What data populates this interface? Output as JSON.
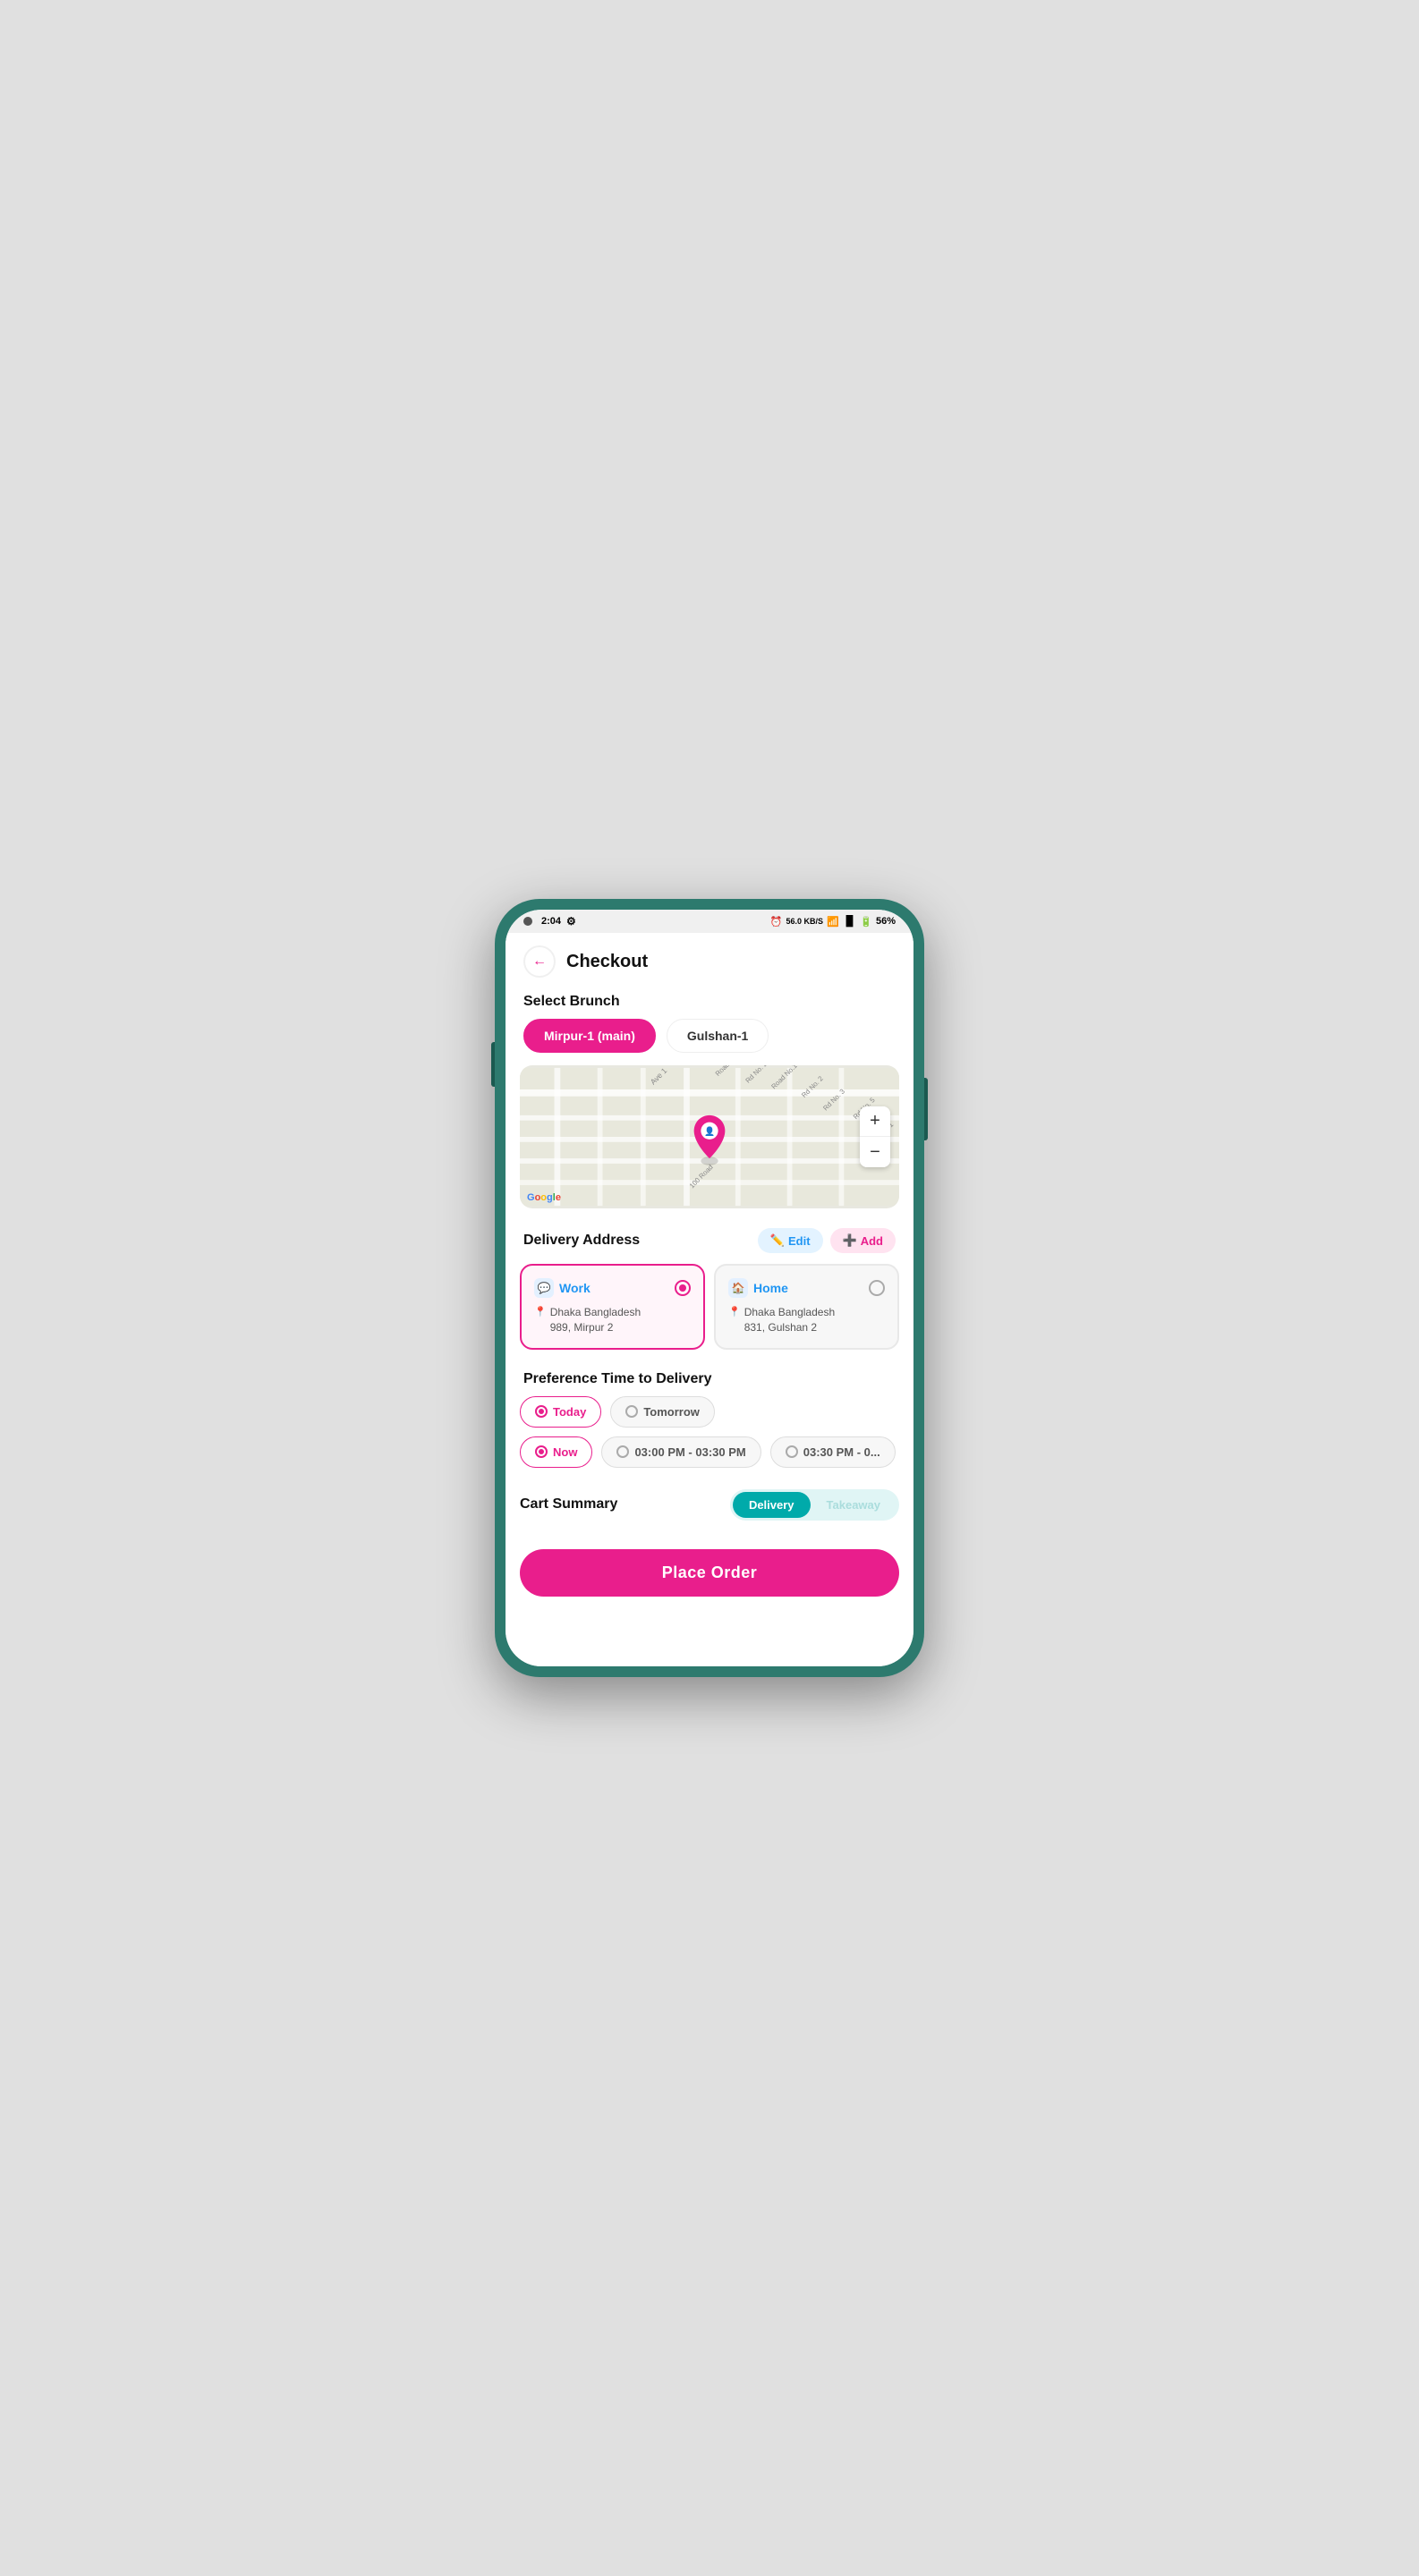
{
  "status_bar": {
    "time": "2:04",
    "battery": "56%",
    "signal": "56.0 KB/S"
  },
  "header": {
    "title": "Checkout",
    "back_label": "←"
  },
  "branch_section": {
    "title": "Select Brunch",
    "branches": [
      {
        "label": "Mirpur-1 (main)",
        "active": true
      },
      {
        "label": "Gulshan-1",
        "active": false
      }
    ]
  },
  "delivery_address": {
    "title": "Delivery Address",
    "edit_label": "Edit",
    "add_label": "Add",
    "addresses": [
      {
        "type": "Work",
        "icon": "💬",
        "city": "Dhaka Bangladesh",
        "detail": "989, Mirpur 2",
        "selected": true
      },
      {
        "type": "Home",
        "icon": "🏠",
        "city": "Dhaka Bangladesh",
        "detail": "831, Gulshan 2",
        "selected": false
      }
    ]
  },
  "time_preference": {
    "title": "Preference Time to Delivery",
    "day_options": [
      {
        "label": "Today",
        "selected": true
      },
      {
        "label": "Tomorrow",
        "selected": false
      }
    ],
    "time_options": [
      {
        "label": "Now",
        "selected": true
      },
      {
        "label": "03:00 PM - 03:30 PM",
        "selected": false
      },
      {
        "label": "03:30 PM - 0...",
        "selected": false
      }
    ]
  },
  "cart_summary": {
    "title": "Cart Summary",
    "delivery_label": "Delivery",
    "takeaway_label": "Takeaway"
  },
  "place_order": {
    "label": "Place Order"
  },
  "map": {
    "plus_label": "+",
    "minus_label": "−",
    "google_text": "Google"
  }
}
